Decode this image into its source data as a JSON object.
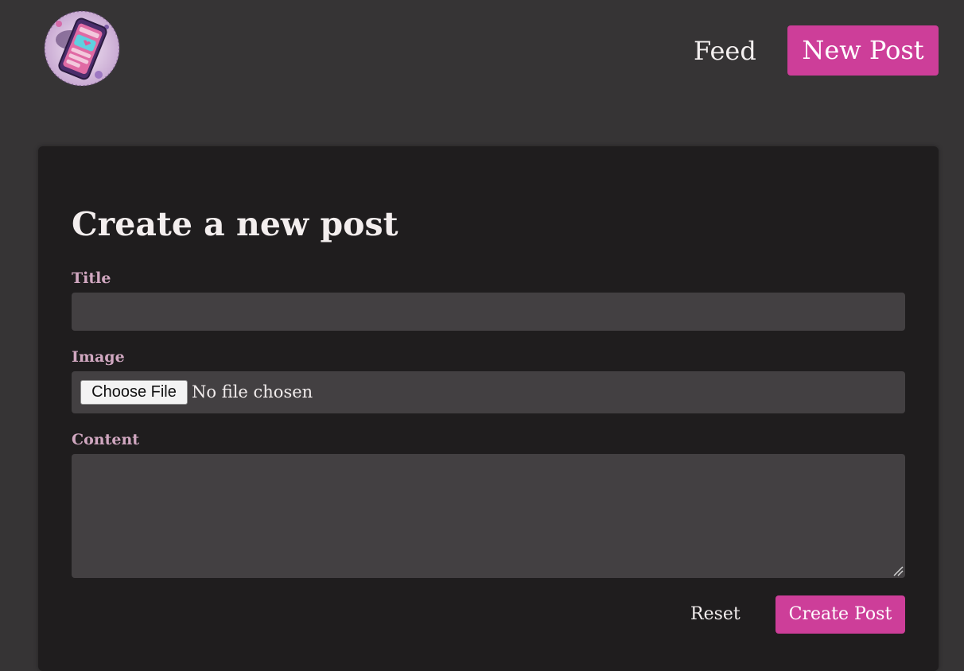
{
  "header": {
    "logo_icon": "phone-app-logo-icon",
    "nav": {
      "feed_label": "Feed",
      "new_post_label": "New Post"
    }
  },
  "form": {
    "title": "Create a new post",
    "fields": {
      "title_label": "Title",
      "title_value": "",
      "image_label": "Image",
      "choose_file_label": "Choose File",
      "no_file_text": "No file chosen",
      "content_label": "Content",
      "content_value": ""
    },
    "actions": {
      "reset_label": "Reset",
      "submit_label": "Create Post"
    }
  },
  "colors": {
    "page_background": "#363435",
    "card_background": "#1f1d1e",
    "input_background": "#434042",
    "accent": "#cd3e99",
    "label_color": "#d0a7c0"
  }
}
